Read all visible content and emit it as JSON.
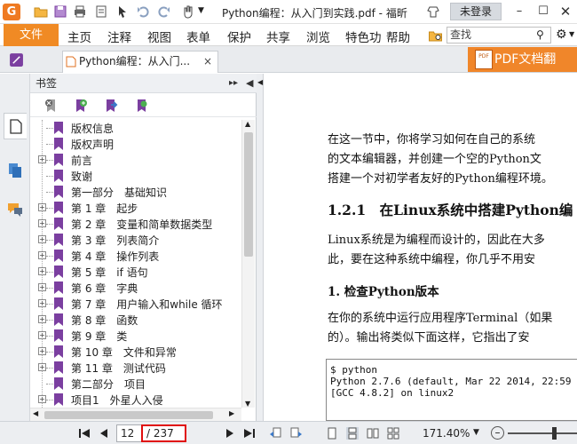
{
  "titlebar": {
    "logo_letter": "G",
    "title": "Python编程：从入门到实践.pdf - 福昕",
    "login_label": "未登录",
    "minimize_glyph": "–",
    "maximize_glyph": "☐"
  },
  "menubar": {
    "file_label": "文件",
    "items": [
      "主页",
      "注释",
      "视图",
      "表单",
      "保护",
      "共享",
      "浏览",
      "特色功",
      "帮助"
    ],
    "search_placeholder": "查找"
  },
  "tabs": {
    "doc_tab_label": "Python编程：从入门...",
    "close_glyph": "×",
    "banner_label": "PDF文档翻",
    "banner_badge": "PDF"
  },
  "bookmarks": {
    "header_title": "书签",
    "header_expand_glyph": "▸▸",
    "items": [
      {
        "label": "版权信息",
        "expandable": false
      },
      {
        "label": "版权声明",
        "expandable": false
      },
      {
        "label": "前言",
        "expandable": true
      },
      {
        "label": "致谢",
        "expandable": false
      },
      {
        "label": "第一部分　基础知识",
        "expandable": false
      },
      {
        "label": "第 1 章　起步",
        "expandable": true
      },
      {
        "label": "第 2 章　变量和简单数据类型",
        "expandable": true
      },
      {
        "label": "第 3 章　列表简介",
        "expandable": true
      },
      {
        "label": "第 4 章　操作列表",
        "expandable": true
      },
      {
        "label": "第 5 章　if 语句",
        "expandable": true
      },
      {
        "label": "第 6 章　字典",
        "expandable": true
      },
      {
        "label": "第 7 章　用户输入和while 循环",
        "expandable": true
      },
      {
        "label": "第 8 章　函数",
        "expandable": true
      },
      {
        "label": "第 9 章　类",
        "expandable": true
      },
      {
        "label": "第 10 章　文件和异常",
        "expandable": true
      },
      {
        "label": "第 11 章　测试代码",
        "expandable": true
      },
      {
        "label": "第二部分　项目",
        "expandable": false
      },
      {
        "label": "项目1　外星人入侵",
        "expandable": true
      }
    ]
  },
  "document": {
    "intro_lines": [
      "在这一节中，你将学习如何在自己的系统",
      "的文本编辑器，并创建一个空的Python文",
      "搭建一个对初学者友好的Python编程环境。"
    ],
    "section_heading": "1.2.1　在Linux系统中搭建Python编",
    "linux_lines": [
      "Linux系统是为编程而设计的，因此在大多",
      "此，要在这种系统中编程，你几乎不用安"
    ],
    "subsection_heading": "1. 检查Python版本",
    "check_lines": [
      "在你的系统中运行应用程序Terminal（如果",
      "的）。输出将类似下面这样，它指出了安"
    ],
    "code_lines": [
      "$ python",
      "Python 2.7.6 (default, Mar 22 2014, 22:59",
      "[GCC 4.8.2] on linux2"
    ]
  },
  "statusbar": {
    "current_page": "12",
    "total_pages": "/ 237",
    "zoom_level": "171.40%",
    "zoom_dropdown_glyph": "▼",
    "zoom_out_glyph": "–"
  },
  "colors": {
    "accent_orange": "#f08a24",
    "bookmark_purple": "#7b3fa0",
    "page_highlight_red": "#e00d0d"
  }
}
